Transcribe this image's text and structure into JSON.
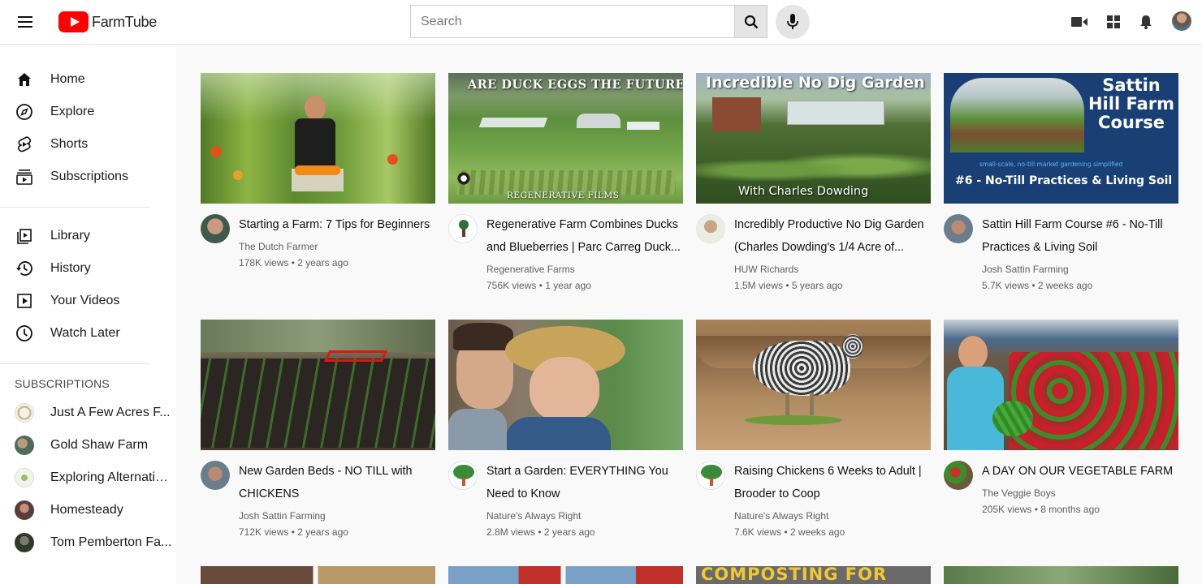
{
  "app": {
    "name": "FarmTube"
  },
  "search": {
    "placeholder": "Search"
  },
  "sidebar": {
    "main": [
      {
        "label": "Home",
        "icon": "home-icon"
      },
      {
        "label": "Explore",
        "icon": "compass-icon"
      },
      {
        "label": "Shorts",
        "icon": "shorts-icon"
      },
      {
        "label": "Subscriptions",
        "icon": "subscriptions-icon"
      }
    ],
    "library": [
      {
        "label": "Library",
        "icon": "library-icon"
      },
      {
        "label": "History",
        "icon": "history-icon"
      },
      {
        "label": "Your Videos",
        "icon": "your-videos-icon"
      },
      {
        "label": "Watch Later",
        "icon": "clock-icon"
      }
    ],
    "subscriptions_title": "SUBSCRIPTIONS",
    "subscriptions": [
      {
        "label": "Just A Few Acres F..."
      },
      {
        "label": "Gold Shaw Farm"
      },
      {
        "label": "Exploring Alternatives"
      },
      {
        "label": "Homesteady"
      },
      {
        "label": "Tom Pemberton Fa..."
      }
    ]
  },
  "videos": [
    {
      "title": "Starting a Farm: 7 Tips for Beginners",
      "channel": "The Dutch Farmer",
      "meta": "178K views • 2 years ago"
    },
    {
      "title": "Regenerative Farm Combines Ducks and Blueberries | Parc Carreg Duck...",
      "channel": "Regenerative Farms",
      "meta": "756K views • 1 year ago",
      "thumb_top": "ARE DUCK EGGS THE FUTURE?",
      "thumb_bottom": "REGENERATIVE FILMS"
    },
    {
      "title": "Incredibly Productive No Dig Garden (Charles Dowding's 1/4 Acre of...",
      "channel": "HUW Richards",
      "meta": "1.5M views • 5 years ago",
      "thumb_top": "Incredible No Dig Garden",
      "thumb_bottom": "With Charles Dowding"
    },
    {
      "title": "Sattin Hill Farm Course #6 - No-Till Practices & Living Soil",
      "channel": "Josh Sattin Farming",
      "meta": "5.7K views • 2 weeks ago",
      "thumb_title": "Sattin Hill Farm Course",
      "thumb_small": "small-scale, no-till market gardening simplified",
      "thumb_bottom": "#6 - No-Till Practices & Living Soil"
    },
    {
      "title": "New Garden Beds - NO TILL with CHICKENS",
      "channel": "Josh Sattin Farming",
      "meta": "712K views • 2 years ago"
    },
    {
      "title": "Start a Garden: EVERYTHING You Need to Know",
      "channel": "Nature's Always Right",
      "meta": "2.8M views • 2 years ago"
    },
    {
      "title": "Raising Chickens 6 Weeks to Adult | Brooder to Coop",
      "channel": "Nature's Always Right",
      "meta": "7.6K views • 2 weeks ago"
    },
    {
      "title": "A DAY ON OUR VEGETABLE FARM",
      "channel": "The Veggie Boys",
      "meta": "205K views • 8 months ago"
    }
  ],
  "row3": {
    "composting_text": "COMPOSTING FOR"
  }
}
